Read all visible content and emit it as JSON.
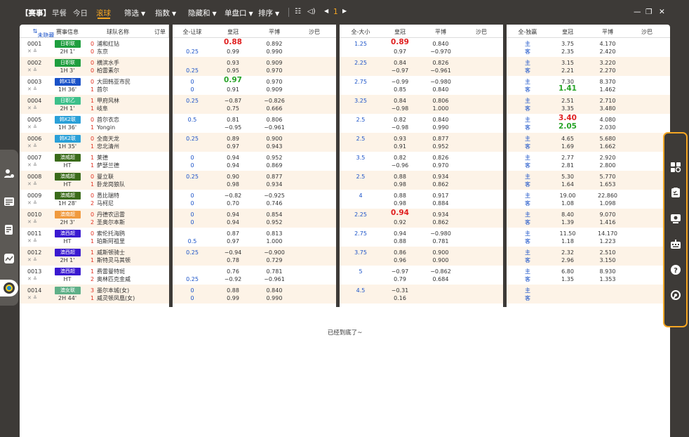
{
  "topbar": {
    "brand": "【赛事】",
    "nav": [
      "早餐",
      "今日",
      "滚球"
    ],
    "filters": [
      "筛选",
      "指数",
      "隐藏和",
      "单盘口",
      "排序"
    ],
    "page": "1"
  },
  "headers": {
    "col_hide": "未隐藏",
    "col_info": "赛事信息",
    "col_team": "球队名称",
    "col_order": "订单",
    "g1_title": "全-让球",
    "g2_title": "全-大小",
    "g3_title": "全-独赢",
    "book1": "皇冠",
    "book2": "平博",
    "book3": "沙巴"
  },
  "rows": [
    {
      "id": "0001",
      "time": "2H 1'",
      "league": "日职联",
      "lcolor": "#1e9e3e",
      "s1": "0",
      "s2": "0",
      "t1": "浦和红钻",
      "t2": "东京",
      "hcp1": "",
      "hcp2": "0.25",
      "hc1": "0.88",
      "hc2": "0.99",
      "hc1c": "red",
      "hp1": "0.892",
      "hp2": "0.990",
      "ou1": "1.25",
      "ou2": "",
      "oc1": "0.89",
      "oc2": "0.97",
      "oc1c": "red",
      "op1": "0.840",
      "op2": "−0.970",
      "wl1": "主",
      "wl2": "客",
      "mc1": "3.75",
      "mc2": "2.35",
      "mc1c": "",
      "mc2c": "",
      "mp1": "4.170",
      "mp2": "2.420"
    },
    {
      "id": "0002",
      "time": "1H 3'",
      "league": "日职联",
      "lcolor": "#1e9e3e",
      "s1": "0",
      "s2": "0",
      "t1": "横滨水手",
      "t2": "柏雷素尔",
      "hcp1": "",
      "hcp2": "0.25",
      "hc1": "0.93",
      "hc2": "0.95",
      "hc1c": "",
      "hp1": "0.909",
      "hp2": "0.970",
      "ou1": "2.25",
      "ou2": "",
      "oc1": "0.84",
      "oc2": "−0.97",
      "oc1c": "",
      "op1": "0.826",
      "op2": "−0.961",
      "wl1": "主",
      "wl2": "客",
      "mc1": "3.15",
      "mc2": "2.21",
      "mc1c": "",
      "mc2c": "",
      "mp1": "3.220",
      "mp2": "2.270"
    },
    {
      "id": "0003",
      "time": "1H 36'",
      "league": "韩K1联",
      "lcolor": "#1a52c8",
      "s1": "0",
      "s2": "1",
      "t1": "大田韩亚市民",
      "t2": "首尔",
      "hcp1": "0",
      "hcp2": "0",
      "hc1": "0.97",
      "hc2": "0.91",
      "hc1c": "green",
      "hp1": "0.970",
      "hp2": "0.909",
      "ou1": "2.75",
      "ou2": "",
      "oc1": "−0.99",
      "oc2": "0.85",
      "oc1c": "",
      "op1": "−0.980",
      "op2": "0.840",
      "wl1": "主",
      "wl2": "客",
      "mc1": "7.30",
      "mc2": "1.41",
      "mc1c": "",
      "mc2c": "green",
      "mp1": "8.370",
      "mp2": "1.462"
    },
    {
      "id": "0004",
      "time": "2H 1'",
      "league": "日职乙",
      "lcolor": "#3cc08a",
      "s1": "1",
      "s2": "1",
      "t1": "甲府风林",
      "t2": "岐阜",
      "hcp1": "0.25",
      "hcp2": "",
      "hc1": "−0.87",
      "hc2": "0.75",
      "hc1c": "",
      "hp1": "−0.826",
      "hp2": "0.666",
      "ou1": "3.25",
      "ou2": "",
      "oc1": "0.84",
      "oc2": "−0.98",
      "oc1c": "",
      "op1": "0.806",
      "op2": "1.000",
      "wl1": "主",
      "wl2": "客",
      "mc1": "2.51",
      "mc2": "3.35",
      "mc1c": "",
      "mc2c": "",
      "mp1": "2.710",
      "mp2": "3.480"
    },
    {
      "id": "0005",
      "time": "1H 36'",
      "league": "韩K2联",
      "lcolor": "#2aa0d8",
      "s1": "0",
      "s2": "1",
      "t1": "首尔衣恋",
      "t2": "Yongin",
      "hcp1": "0.5",
      "hcp2": "",
      "hc1": "0.81",
      "hc2": "−0.95",
      "hc1c": "",
      "hp1": "0.806",
      "hp2": "−0.961",
      "ou1": "2.5",
      "ou2": "",
      "oc1": "0.82",
      "oc2": "−0.98",
      "oc1c": "",
      "op1": "0.840",
      "op2": "0.990",
      "wl1": "主",
      "wl2": "客",
      "mc1": "3.40",
      "mc2": "2.05",
      "mc1c": "red",
      "mc2c": "green",
      "mp1": "4.080",
      "mp2": "2.030"
    },
    {
      "id": "0006",
      "time": "1H 35'",
      "league": "韩K2联",
      "lcolor": "#2aa0d8",
      "s1": "0",
      "s2": "1",
      "t1": "全南天龙",
      "t2": "忠北清州",
      "hcp1": "0.25",
      "hcp2": "",
      "hc1": "0.89",
      "hc2": "0.97",
      "hc1c": "",
      "hp1": "0.900",
      "hp2": "0.943",
      "ou1": "2.5",
      "ou2": "",
      "oc1": "0.93",
      "oc2": "0.91",
      "oc1c": "",
      "op1": "0.877",
      "op2": "0.952",
      "wl1": "主",
      "wl2": "客",
      "mc1": "4.65",
      "mc2": "1.69",
      "mc1c": "",
      "mc2c": "",
      "mp1": "5.680",
      "mp2": "1.662"
    },
    {
      "id": "0007",
      "time": "HT",
      "league": "澳威超",
      "lcolor": "#3a6b1a",
      "s1": "1",
      "s2": "1",
      "t1": "莱德",
      "t2": "萨瑟兰德",
      "hcp1": "0",
      "hcp2": "0",
      "hc1": "0.94",
      "hc2": "0.94",
      "hc1c": "",
      "hp1": "0.952",
      "hp2": "0.869",
      "ou1": "3.5",
      "ou2": "",
      "oc1": "0.82",
      "oc2": "−0.96",
      "oc1c": "",
      "op1": "0.826",
      "op2": "0.970",
      "wl1": "主",
      "wl2": "客",
      "mc1": "2.77",
      "mc2": "2.81",
      "mc1c": "",
      "mc2c": "",
      "mp1": "2.920",
      "mp2": "2.800"
    },
    {
      "id": "0008",
      "time": "HT",
      "league": "澳威超",
      "lcolor": "#3a6b1a",
      "s1": "0",
      "s2": "1",
      "t1": "曼立联",
      "t2": "卧龙岗狼队",
      "hcp1": "0.25",
      "hcp2": "",
      "hc1": "0.90",
      "hc2": "0.98",
      "hc1c": "",
      "hp1": "0.877",
      "hp2": "0.934",
      "ou1": "2.5",
      "ou2": "",
      "oc1": "0.88",
      "oc2": "0.98",
      "oc1c": "",
      "op1": "0.934",
      "op2": "0.862",
      "wl1": "主",
      "wl2": "客",
      "mc1": "5.30",
      "mc2": "1.64",
      "mc1c": "",
      "mc2c": "",
      "mp1": "5.770",
      "mp2": "1.653"
    },
    {
      "id": "0009",
      "time": "1H 28'",
      "league": "澳威超",
      "lcolor": "#3a6b1a",
      "s1": "0",
      "s2": "2",
      "t1": "悉比瑞特",
      "t2": "马柯尼",
      "hcp1": "0",
      "hcp2": "0",
      "hc1": "−0.82",
      "hc2": "0.70",
      "hc1c": "",
      "hp1": "−0.925",
      "hp2": "0.746",
      "ou1": "4",
      "ou2": "",
      "oc1": "0.88",
      "oc2": "0.98",
      "oc1c": "",
      "op1": "0.917",
      "op2": "0.884",
      "wl1": "主",
      "wl2": "客",
      "mc1": "19.00",
      "mc2": "1.08",
      "mc1c": "",
      "mc2c": "",
      "mp1": "22.860",
      "mp2": "1.098"
    },
    {
      "id": "0010",
      "time": "2H 3'",
      "league": "澳南超",
      "lcolor": "#f09a3e",
      "s1": "0",
      "s2": "2",
      "t1": "丹德农迅雷",
      "t2": "圣奥尔本斯",
      "hcp1": "0",
      "hcp2": "0",
      "hc1": "0.94",
      "hc2": "0.94",
      "hc1c": "",
      "hp1": "0.854",
      "hp2": "0.952",
      "ou1": "2.25",
      "ou2": "",
      "oc1": "0.94",
      "oc2": "0.92",
      "oc1c": "red",
      "op1": "0.934",
      "op2": "0.862",
      "wl1": "主",
      "wl2": "客",
      "mc1": "8.40",
      "mc2": "1.39",
      "mc1c": "",
      "mc2c": "",
      "mp1": "9.070",
      "mp2": "1.416"
    },
    {
      "id": "0011",
      "time": "HT",
      "league": "澳西超",
      "lcolor": "#3a1ad0",
      "s1": "0",
      "s2": "1",
      "t1": "索伦托海鸥",
      "t2": "珀斯阿祖里",
      "hcp1": "",
      "hcp2": "0.5",
      "hc1": "0.87",
      "hc2": "0.97",
      "hc1c": "",
      "hp1": "0.813",
      "hp2": "1.000",
      "ou1": "2.75",
      "ou2": "",
      "oc1": "0.94",
      "oc2": "0.88",
      "oc1c": "",
      "op1": "−0.980",
      "op2": "0.781",
      "wl1": "主",
      "wl2": "客",
      "mc1": "11.50",
      "mc2": "1.18",
      "mc1c": "",
      "mc2c": "",
      "mp1": "14.170",
      "mp2": "1.223"
    },
    {
      "id": "0012",
      "time": "2H 1'",
      "league": "澳西超",
      "lcolor": "#3a1ad0",
      "s1": "1",
      "s2": "1",
      "t1": "威斯顿骑士",
      "t2": "斯特灵马其顿",
      "hcp1": "0.25",
      "hcp2": "",
      "hc1": "−0.94",
      "hc2": "0.78",
      "hc1c": "",
      "hp1": "−0.900",
      "hp2": "0.729",
      "ou1": "3.75",
      "ou2": "",
      "oc1": "0.86",
      "oc2": "0.96",
      "oc1c": "",
      "op1": "0.900",
      "op2": "0.900",
      "wl1": "主",
      "wl2": "客",
      "mc1": "2.32",
      "mc2": "2.96",
      "mc1c": "",
      "mc2c": "",
      "mp1": "2.510",
      "mp2": "3.150"
    },
    {
      "id": "0013",
      "time": "HT",
      "league": "澳西超",
      "lcolor": "#3a1ad0",
      "s1": "1",
      "s2": "2",
      "t1": "费雷曼特斑",
      "t2": "奥林匹克金威",
      "hcp1": "",
      "hcp2": "0.25",
      "hc1": "0.76",
      "hc2": "−0.92",
      "hc1c": "",
      "hp1": "0.781",
      "hp2": "−0.961",
      "ou1": "5",
      "ou2": "",
      "oc1": "−0.97",
      "oc2": "0.79",
      "oc1c": "",
      "op1": "−0.862",
      "op2": "0.684",
      "wl1": "主",
      "wl2": "客",
      "mc1": "6.80",
      "mc2": "1.35",
      "mc1c": "",
      "mc2c": "",
      "mp1": "8.930",
      "mp2": "1.353"
    },
    {
      "id": "0014",
      "time": "2H 44'",
      "league": "澳女联",
      "lcolor": "#5fb088",
      "s1": "3",
      "s2": "1",
      "t1": "墨尔本城(女)",
      "t2": "威灵顿凤凰(女)",
      "hcp1": "0",
      "hcp2": "0",
      "hc1": "0.88",
      "hc2": "0.99",
      "hc1c": "",
      "hp1": "0.840",
      "hp2": "0.990",
      "ou1": "4.5",
      "ou2": "",
      "oc1": "−0.31",
      "oc2": "0.16",
      "oc1c": "",
      "op1": "",
      "op2": "",
      "wl1": "主",
      "wl2": "客",
      "mc1": "",
      "mc2": "",
      "mc1c": "",
      "mc2c": "",
      "mp1": "",
      "mp2": ""
    }
  ],
  "footer": "已经到底了~",
  "colors": {
    "accent": "#f5a623",
    "bg": "#3d3a37",
    "row_alt": "#fdf3e7",
    "blue": "#1a52c8",
    "red": "#e02020",
    "green": "#28a428"
  },
  "right_icons": [
    "overview-icon",
    "scoreboard-icon",
    "record-icon",
    "keyboard-icon",
    "help-icon",
    "service-icon"
  ],
  "left_icons": [
    "user-settings-icon",
    "list-icon",
    "betslip-icon",
    "chart-icon",
    "live-ball-icon"
  ]
}
